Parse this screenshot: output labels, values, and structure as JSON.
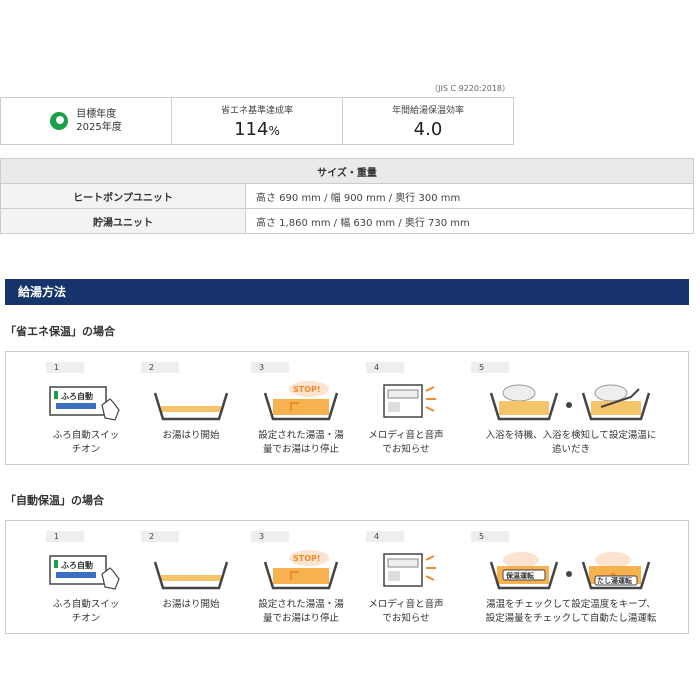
{
  "jis_note": "（JIS C 9220:2018）",
  "performance": {
    "target_label": "目標年度",
    "target_year": "2025年度",
    "achievement_label": "省エネ基準達成率",
    "achievement_value": "114",
    "achievement_unit": "%",
    "efficiency_label": "年間給湯保温効率",
    "efficiency_value": "4.0"
  },
  "spec_table": {
    "header": "サイズ・重量",
    "rows": [
      {
        "name": "ヒートポンプユニット",
        "value": "高さ 690 mm / 幅 900 mm / 奥行 300 mm"
      },
      {
        "name": "貯湯ユニット",
        "value": "高さ 1,860 mm / 幅 630 mm / 奥行 730 mm"
      }
    ]
  },
  "section_title": "給湯方法",
  "mode1": {
    "title": "「省エネ保温」の場合",
    "steps": [
      {
        "num": "1",
        "caption1": "ふろ自動スイッ",
        "caption2": "チオン"
      },
      {
        "num": "2",
        "caption1": "お湯はり開始",
        "caption2": ""
      },
      {
        "num": "3",
        "caption1": "設定された湯温・湯",
        "caption2": "量でお湯はり停止"
      },
      {
        "num": "4",
        "caption1": "メロディ音と音声",
        "caption2": "でお知らせ"
      },
      {
        "num": "5",
        "caption1": "入浴を待機、入浴を検知して設定湯温に",
        "caption2": "追いだき"
      }
    ]
  },
  "mode2": {
    "title": "「自動保温」の場合",
    "steps": [
      {
        "num": "1",
        "caption1": "ふろ自動スイッ",
        "caption2": "チオン"
      },
      {
        "num": "2",
        "caption1": "お湯はり開始",
        "caption2": ""
      },
      {
        "num": "3",
        "caption1": "設定された湯温・湯",
        "caption2": "量でお湯はり停止"
      },
      {
        "num": "4",
        "caption1": "メロディ音と音声",
        "caption2": "でお知らせ"
      },
      {
        "num": "5",
        "caption1": "湯温をチェックして設定温度をキープ、",
        "caption2": "設定湯量をチェックして自動たし湯運転"
      }
    ]
  },
  "labels": {
    "remote_text": "ふろ自動",
    "stop_text": "STOP!",
    "keep_warm": "保温運転",
    "add_water": "たし湯運転"
  },
  "colors": {
    "band": "#17336c",
    "accent_orange": "#f08a2a",
    "eco_green": "#19a049"
  }
}
